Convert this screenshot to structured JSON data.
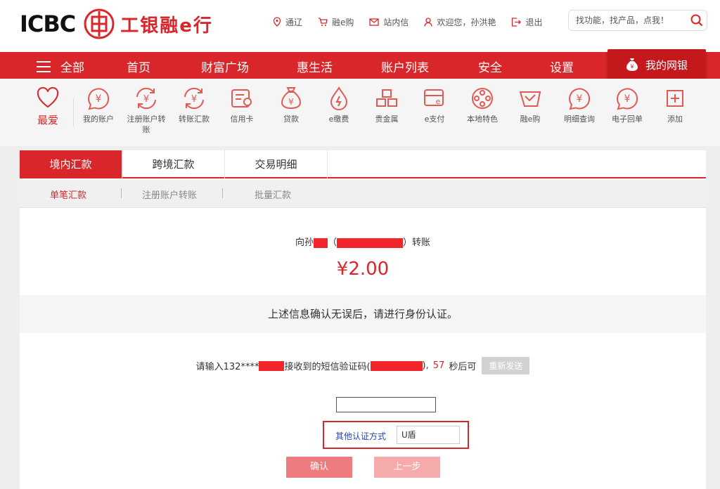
{
  "header": {
    "logo_text": "ICBC",
    "logo_cn": "工银融e行",
    "links": [
      {
        "label": "通辽",
        "icon": "location-pin-icon"
      },
      {
        "label": "融e购",
        "icon": "cart-icon"
      },
      {
        "label": "站内信",
        "icon": "mail-icon"
      },
      {
        "label": "欢迎您，孙洪艳",
        "icon": "user-icon"
      },
      {
        "label": "退出",
        "icon": "logout-icon"
      }
    ],
    "search_placeholder": "找功能，找产品，点我！"
  },
  "nav": {
    "all_label": "全部",
    "items": [
      "首页",
      "财富广场",
      "惠生活",
      "账户列表",
      "安全",
      "设置"
    ],
    "mybank_label": "我的网银"
  },
  "shortcuts": {
    "favorite_label": "最爱",
    "items": [
      {
        "label": "我的账户",
        "icon": "yen-coin-icon"
      },
      {
        "label": "注册账户转账",
        "icon": "yen-exchange-icon"
      },
      {
        "label": "转账汇款",
        "icon": "yen-exchange-icon"
      },
      {
        "label": "信用卡",
        "icon": "credit-card-icon"
      },
      {
        "label": "贷款",
        "icon": "money-bag-icon"
      },
      {
        "label": "e缴费",
        "icon": "drop-bolt-icon"
      },
      {
        "label": "贵金属",
        "icon": "gold-bars-icon"
      },
      {
        "label": "e支付",
        "icon": "e-pay-icon"
      },
      {
        "label": "本地特色",
        "icon": "film-reel-icon"
      },
      {
        "label": "融e购",
        "icon": "shopping-bag-icon"
      },
      {
        "label": "明细查询",
        "icon": "yen-coin-icon"
      },
      {
        "label": "电子回单",
        "icon": "yen-coin-icon"
      },
      {
        "label": "添加",
        "icon": "plus-box-icon"
      }
    ]
  },
  "tabs": [
    "境内汇款",
    "跨境汇款",
    "交易明细"
  ],
  "subtabs": [
    "单笔汇款",
    "注册账户转账",
    "批量汇款"
  ],
  "transfer": {
    "prefix": "向孙",
    "open_paren": "（",
    "close_suffix": "）转账",
    "amount": "¥2.00"
  },
  "confirm_text": "上述信息确认无误后，请进行身份认证。",
  "sms": {
    "part1": "请输入132****",
    "part2": "接收到的短信验证码(",
    "part3": "),",
    "countdown": "57",
    "part4": "秒后可",
    "resend_label": "重新发送"
  },
  "other_auth": {
    "label": "其他认证方式",
    "selected": "U盾"
  },
  "buttons": {
    "confirm": "确认",
    "back": "上一步"
  },
  "colors": {
    "brand_red": "#d9262b",
    "link_blue": "#2447b0"
  }
}
